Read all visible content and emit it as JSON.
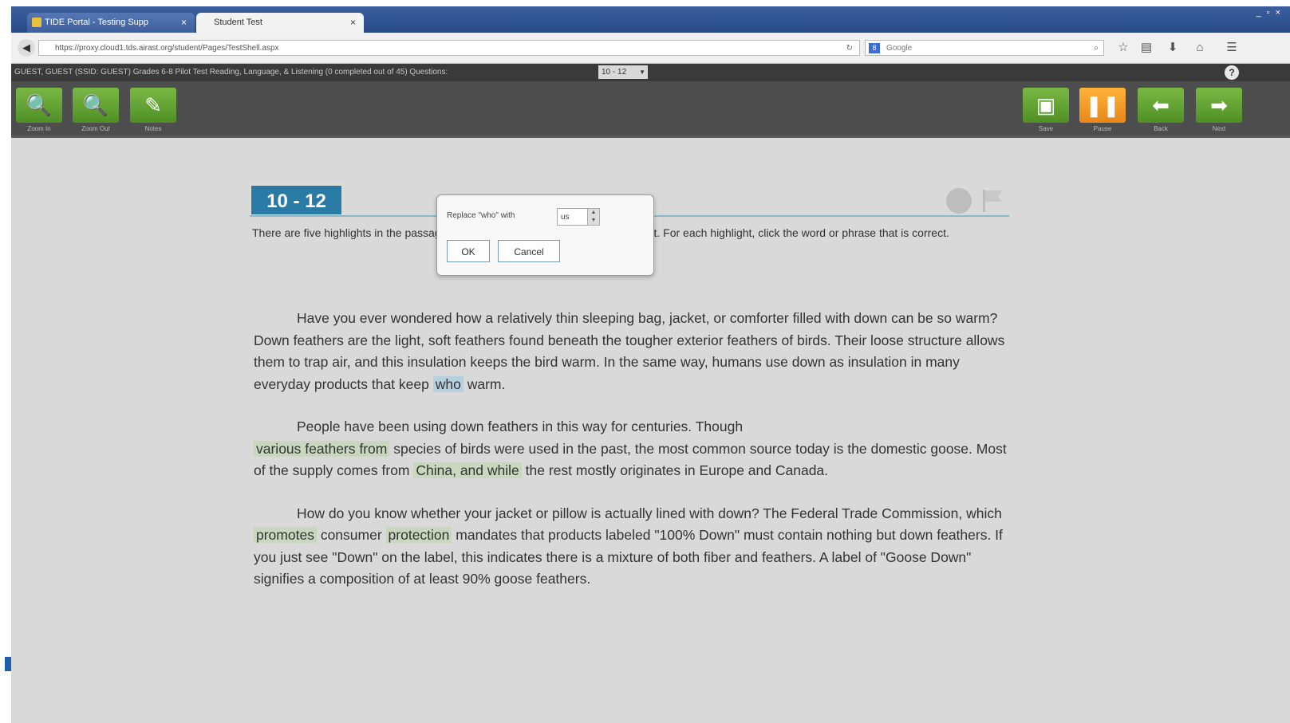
{
  "browser": {
    "tabs": [
      {
        "label": "TIDE Portal - Testing Supp"
      },
      {
        "label": "Student Test"
      }
    ],
    "new_tab_symbol": "+",
    "tab_close_symbol": "×",
    "window_controls": "_ ▫ ×",
    "url": "https://proxy.cloud1.tds.airast.org/student/Pages/TestShell.aspx",
    "search_placeholder": "Google",
    "search_badge": "8"
  },
  "infobar": {
    "text": "GUEST, GUEST (SSID: GUEST)   Grades 6-8 Pilot Test Reading, Language, & Listening (0 completed out of 45)   Questions:",
    "question_select": "10 - 12",
    "help": "?"
  },
  "toolbar": {
    "left_tools": [
      {
        "icon": "zoom-in-icon",
        "glyph": "🔍",
        "label": "Zoom In"
      },
      {
        "icon": "zoom-out-icon",
        "glyph": "🔍",
        "label": "Zoom Out"
      },
      {
        "icon": "notes-icon",
        "glyph": "✎",
        "label": "Notes"
      }
    ],
    "right_tools": [
      {
        "icon": "save-icon",
        "glyph": "▣",
        "label": "Save"
      },
      {
        "icon": "pause-icon",
        "glyph": "❚❚",
        "label": "Pause"
      },
      {
        "icon": "back-arrow-icon",
        "glyph": "⬅",
        "label": "Back"
      },
      {
        "icon": "next-arrow-icon",
        "glyph": "➡",
        "label": "Next"
      }
    ]
  },
  "question": {
    "badge": "10 - 12",
    "instructions": "There are five highlights in the passage. Some words or phrases may be incorrect. For each highlight, click the word or phrase that is correct."
  },
  "passage": {
    "p1_before": "Have you ever wondered how a relatively thin sleeping bag, jacket, or comforter filled with down can be so warm? Down feathers are the light, soft feathers found beneath the tougher exterior feathers of birds. Their loose structure allows them to trap air, and this insulation keeps the bird warm. In the same way, humans use down as insulation in many everyday products that keep",
    "p1_hl": "who",
    "p1_after": "warm.",
    "p2_before": "People have been using down feathers in this way for centuries. Though",
    "p2_hl1": "various feathers from",
    "p2_mid": "species of birds were used in the past, the most common source today is the domestic goose. Most of the supply comes from",
    "p2_hl2": "China, and while",
    "p2_after": "the rest mostly originates in Europe and Canada.",
    "p3_before": "How do you know whether your jacket or pillow is actually lined with down? The Federal Trade Commission, which",
    "p3_hl1": "promotes",
    "p3_mid": "consumer",
    "p3_hl2": "protection",
    "p3_after": "mandates that products labeled \"100% Down\" must contain nothing but down feathers. If you just see \"Down\" on the label, this indicates there is a mixture of both fiber and feathers. A label of \"Goose Down\" signifies a composition of at least 90% goose feathers."
  },
  "dialog": {
    "label": "Replace \"who\" with",
    "select_value": "us",
    "ok": "OK",
    "cancel": "Cancel"
  },
  "colors": {
    "accent_blue": "#2a7aa6",
    "tool_green": "#5a9e2f",
    "tool_orange": "#f39a24",
    "highlight_green": "#c8d7bd",
    "highlight_selected": "#b7d0de"
  }
}
